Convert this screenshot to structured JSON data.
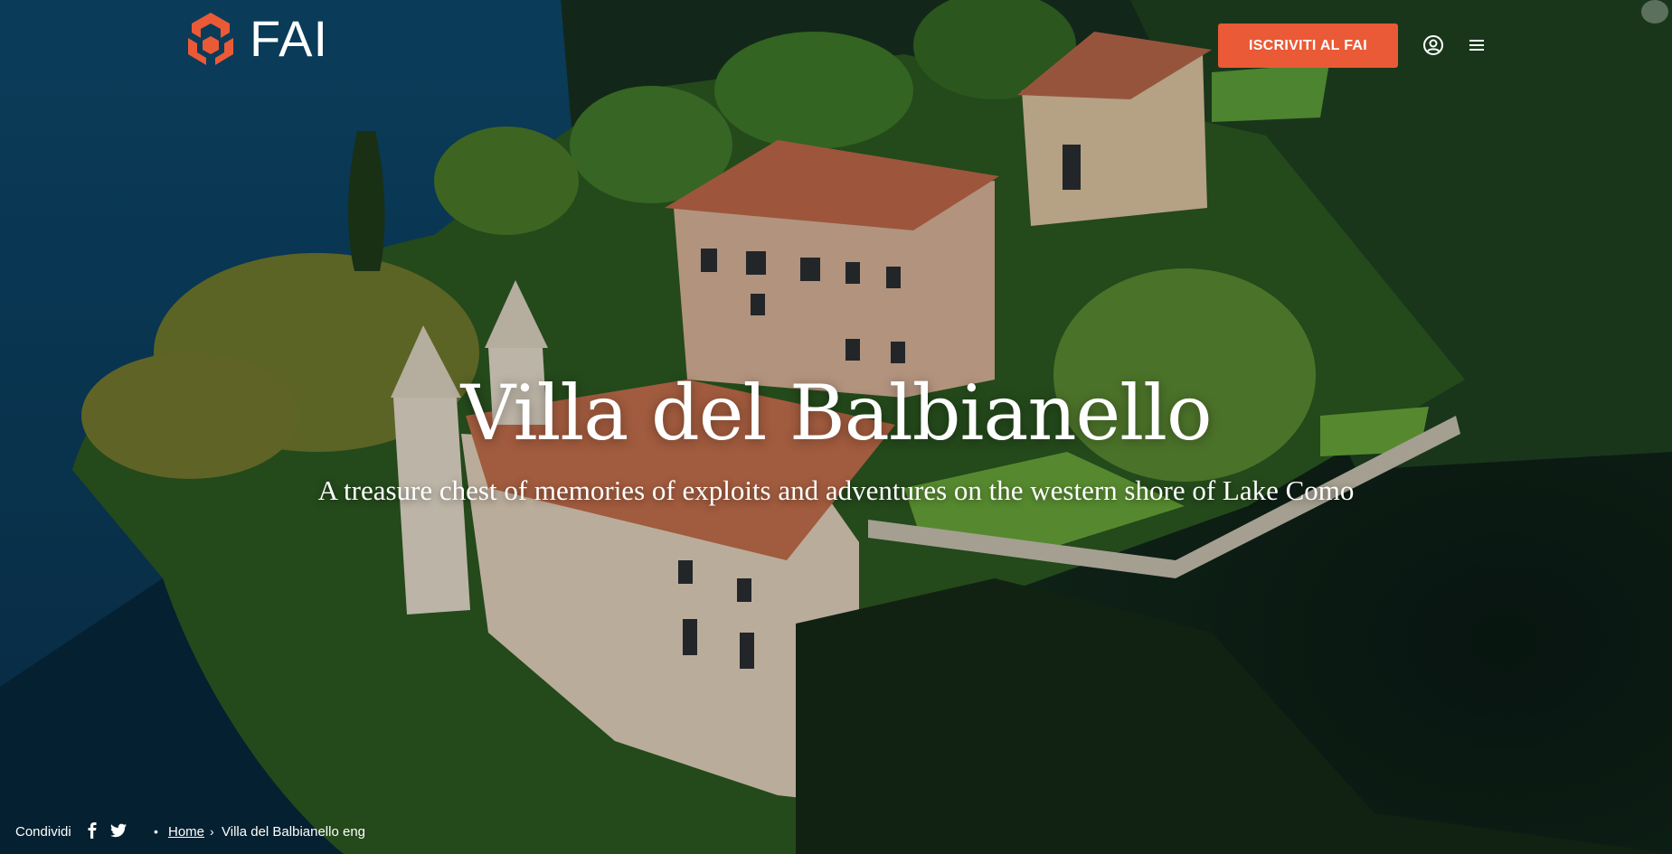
{
  "header": {
    "logo_text": "FAI",
    "join_button": "ISCRIVITI AL FAI",
    "accent_color": "#ea5a36",
    "user_icon": "user-circle-icon",
    "menu_icon": "hamburger-menu-icon"
  },
  "hero": {
    "title": "Villa del Balbianello",
    "subtitle": "A treasure chest of memories of exploits and adventures on the western shore of Lake Como"
  },
  "share": {
    "label": "Condividi",
    "facebook_icon": "facebook-icon",
    "twitter_icon": "twitter-icon"
  },
  "breadcrumb": {
    "separator_dot": "•",
    "home": "Home",
    "separator": "›",
    "current": "Villa del Balbianello eng"
  }
}
